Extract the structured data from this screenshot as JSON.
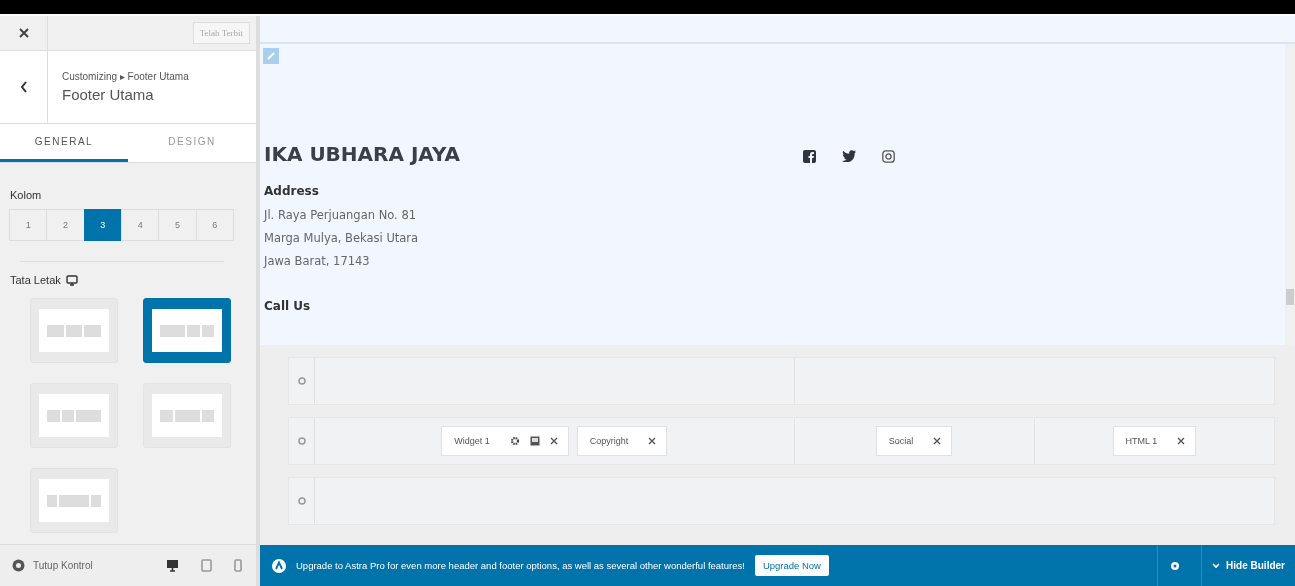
{
  "sidebar": {
    "publish_button": {
      "label": "Telah Terbit",
      "disabled": true
    },
    "breadcrumb": "Customizing ▸ Footer Utama",
    "title": "Footer Utama",
    "tabs": [
      {
        "label": "GENERAL",
        "selected": true
      },
      {
        "label": "DESIGN",
        "selected": false
      }
    ],
    "columns_label": "Kolom",
    "column_options": [
      {
        "label": "1",
        "selected": false
      },
      {
        "label": "2",
        "selected": false
      },
      {
        "label": "3",
        "selected": true
      },
      {
        "label": "4",
        "selected": false
      },
      {
        "label": "5",
        "selected": false
      },
      {
        "label": "6",
        "selected": false
      }
    ],
    "layout_label": "Tata Letak",
    "layouts": [
      {
        "kind": "equal",
        "selected": false
      },
      {
        "kind": "left-wide",
        "selected": true
      },
      {
        "kind": "right-wide",
        "selected": false
      },
      {
        "kind": "center-wide",
        "selected": false
      },
      {
        "kind": "center-wider",
        "selected": false
      }
    ],
    "footer": {
      "label": "Tutup Kontrol",
      "devices": [
        {
          "kind": "desktop",
          "selected": true
        },
        {
          "kind": "tablet",
          "selected": false
        },
        {
          "kind": "mobile",
          "selected": false
        }
      ]
    }
  },
  "preview": {
    "site_title": "IKA UBHARA JAYA",
    "blocks": [
      {
        "heading": "Address",
        "lines": [
          "Jl. Raya Perjuangan No. 81",
          "Marga Mulya, Bekasi Utara",
          "Jawa Barat, 17143"
        ]
      },
      {
        "heading": "Call Us"
      }
    ],
    "social": [
      {
        "kind": "facebook"
      },
      {
        "kind": "twitter"
      },
      {
        "kind": "instagram"
      }
    ]
  },
  "builder": {
    "rows": [
      {
        "columns": [
          {
            "kind": "half"
          },
          {
            "kind": "half"
          }
        ]
      },
      {
        "columns": [
          {
            "kind": "half",
            "items": [
              {
                "label": "Widget 1",
                "kind": "widget"
              },
              {
                "label": "Copyright",
                "kind": "plain"
              }
            ]
          },
          {
            "kind": "quarter",
            "items": [
              {
                "label": "Social",
                "kind": "plain"
              }
            ]
          },
          {
            "kind": "quarter",
            "items": [
              {
                "label": "HTML 1",
                "kind": "plain"
              }
            ]
          }
        ]
      },
      {
        "columns": [
          {
            "kind": "full"
          }
        ]
      }
    ]
  },
  "promo": {
    "message": "Upgrade to Astra Pro for even more header and footer options, as well as several other wonderful features!",
    "button": "Upgrade Now",
    "hide_label": "Hide Builder"
  }
}
